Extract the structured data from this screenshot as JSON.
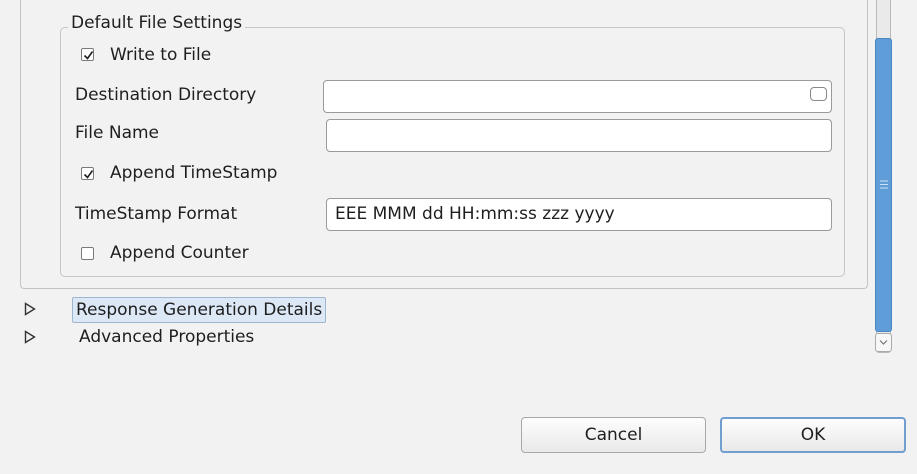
{
  "group": {
    "title": "Default File Settings"
  },
  "write_to_file": {
    "label": "Write to File",
    "checked": true
  },
  "destination_directory": {
    "label": "Destination Directory",
    "value": ""
  },
  "file_name": {
    "label": "File Name",
    "value": ""
  },
  "append_timestamp": {
    "label": "Append TimeStamp",
    "checked": true
  },
  "timestamp_format": {
    "label": "TimeStamp Format",
    "value": "EEE MMM dd HH:mm:ss zzz yyyy"
  },
  "append_counter": {
    "label": "Append Counter",
    "checked": false
  },
  "sections": [
    {
      "label": "Response Generation Details",
      "expanded": false,
      "selected": true
    },
    {
      "label": "Advanced Properties",
      "expanded": false,
      "selected": false
    }
  ],
  "buttons": {
    "cancel": "Cancel",
    "ok": "OK"
  },
  "icons": {
    "checkbox_check": "check-icon",
    "browse": "folder-browse-icon",
    "expander": "triangle-right-icon",
    "scroll_grip": "grip-icon",
    "scroll_down": "chevron-down-icon"
  },
  "colors": {
    "scroll_thumb": "#5f9dd8",
    "ok_border": "#6f9fd0",
    "selection": "#dce8f5"
  }
}
